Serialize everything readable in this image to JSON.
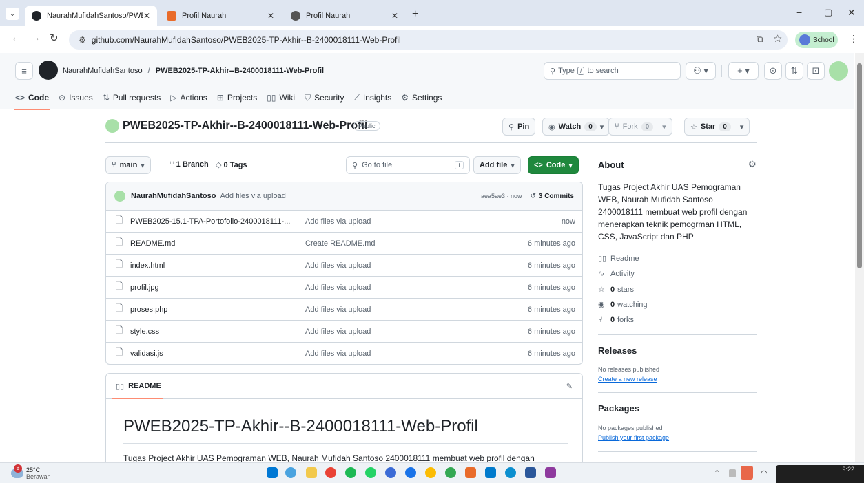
{
  "browser": {
    "tabs": [
      {
        "title": "NaurahMufidahSantoso/PWEB2",
        "active": true
      },
      {
        "title": "Profil Naurah",
        "active": false
      },
      {
        "title": "Profil Naurah",
        "active": false
      }
    ],
    "url": "github.com/NaurahMufidahSantoso/PWEB2025-TP-Akhir--B-2400018111-Web-Profil",
    "profile_label": "School"
  },
  "github": {
    "owner": "NaurahMufidahSantoso",
    "separator": "/",
    "repo": "PWEB2025-TP-Akhir--B-2400018111-Web-Profil",
    "search_placeholder_pre": "Type",
    "search_key": "/",
    "search_placeholder_post": "to search",
    "tabs": [
      {
        "label": "Code",
        "icon": "code-icon"
      },
      {
        "label": "Issues",
        "icon": "issue-icon"
      },
      {
        "label": "Pull requests",
        "icon": "pull-request-icon"
      },
      {
        "label": "Actions",
        "icon": "play-icon"
      },
      {
        "label": "Projects",
        "icon": "table-icon"
      },
      {
        "label": "Wiki",
        "icon": "book-icon"
      },
      {
        "label": "Security",
        "icon": "shield-icon"
      },
      {
        "label": "Insights",
        "icon": "graph-icon"
      },
      {
        "label": "Settings",
        "icon": "gear-icon"
      }
    ]
  },
  "repo_header": {
    "name": "PWEB2025-TP-Akhir--B-2400018111-Web-Profil",
    "visibility": "Public",
    "pin": "Pin",
    "watch": "Watch",
    "watch_count": "0",
    "fork": "Fork",
    "fork_count": "0",
    "star": "Star",
    "star_count": "0"
  },
  "toolbar": {
    "branch": "main",
    "branches": "1 Branch",
    "tags": "0 Tags",
    "goto_placeholder": "Go to file",
    "goto_key": "t",
    "add_file": "Add file",
    "code": "Code"
  },
  "commit": {
    "author": "NaurahMufidahSantoso",
    "message": "Add files via upload",
    "meta": "aea5ae3 · now",
    "commits": "3 Commits"
  },
  "files": [
    {
      "name": "PWEB2025-15.1-TPA-Portofolio-2400018111-...",
      "message": "Add files via upload",
      "time": "now"
    },
    {
      "name": "README.md",
      "message": "Create README.md",
      "time": "6 minutes ago"
    },
    {
      "name": "index.html",
      "message": "Add files via upload",
      "time": "6 minutes ago"
    },
    {
      "name": "profil.jpg",
      "message": "Add files via upload",
      "time": "6 minutes ago"
    },
    {
      "name": "proses.php",
      "message": "Add files via upload",
      "time": "6 minutes ago"
    },
    {
      "name": "style.css",
      "message": "Add files via upload",
      "time": "6 minutes ago"
    },
    {
      "name": "validasi.js",
      "message": "Add files via upload",
      "time": "6 minutes ago"
    }
  ],
  "readme": {
    "tab": "README",
    "heading": "PWEB2025-TP-Akhir--B-2400018111-Web-Profil",
    "text": "Tugas Project Akhir UAS Pemograman WEB, Naurah Mufidah Santoso 2400018111 membuat web profil dengan"
  },
  "about": {
    "title": "About",
    "description": "Tugas Project Akhir UAS Pemograman WEB, Naurah Mufidah Santoso 2400018111 membuat web profil dengan menerapkan teknik pemogrman HTML, CSS, JavaScript dan PHP",
    "readme": "Readme",
    "activity": "Activity",
    "stars_num": "0",
    "stars": "stars",
    "watching_num": "0",
    "watching": "watching",
    "forks_num": "0",
    "forks": "forks"
  },
  "releases": {
    "title": "Releases",
    "none": "No releases published",
    "create": "Create a new release"
  },
  "packages": {
    "title": "Packages",
    "none": "No packages published",
    "publish": "Publish your first package"
  },
  "taskbar": {
    "weather_temp": "25°C",
    "weather_text": "Berawan",
    "weather_badge": "8",
    "clock": "9:22"
  },
  "colors": {
    "accent_green": "#1f883d",
    "link_blue": "#0969da",
    "tab_underline": "#fd8c73"
  }
}
